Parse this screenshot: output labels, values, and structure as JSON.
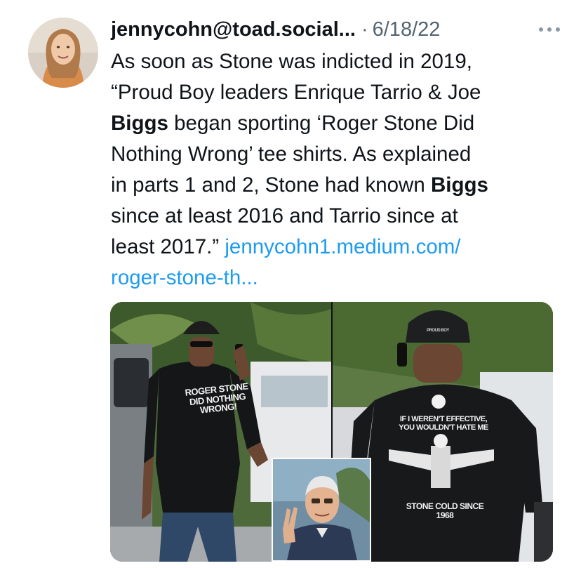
{
  "tweet": {
    "author": "jennycohn@toad.social...",
    "separator": "·",
    "date": "6/18/22",
    "text": {
      "l1": "As soon as Stone was indicted in 2019,",
      "l2": "“Proud Boy leaders Enrique Tarrio & Joe",
      "l3_bold": "Biggs",
      "l3_rest": " began sporting ‘Roger Stone Did",
      "l4": "Nothing Wrong’ tee shirts. As explained",
      "l5_pre": "in parts 1 and 2, Stone had known ",
      "l5_bold": "Biggs",
      "l6": "since at least 2016 and Tarrio since at",
      "l7_pre": "least 2017.” ",
      "link_part1": "jennycohn1.medium.com/",
      "link_part2": "roger-stone-th..."
    },
    "more_icon": "more-horizontal-icon"
  },
  "media": {
    "left_shirt": [
      "ROGER STONE",
      "DID NOTHING",
      "WRONG!"
    ],
    "right_shirt_top": [
      "IF I WEREN'T EFFECTIVE,",
      "YOU WOULDN'T HATE ME"
    ],
    "right_shirt_bottom": "STONE COLD SINCE 1968",
    "right_cap": "PROUD BOY"
  },
  "colors": {
    "link": "#1d9bf0",
    "secondary_text": "#536471",
    "primary_text": "#0f1419"
  }
}
